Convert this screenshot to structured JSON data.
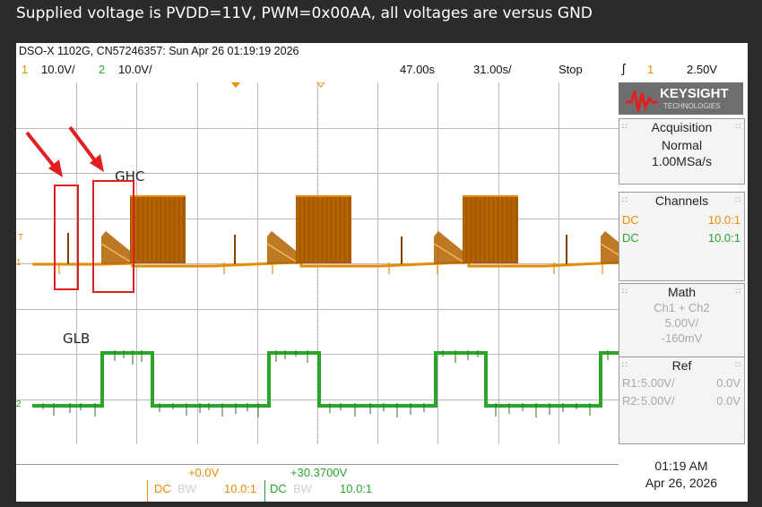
{
  "caption": "Supplied voltage is PVDD=11V, PWM=0x00AA, all voltages are versus GND",
  "status_bar": {
    "model": "DSO-X 1102G, CN57246357: Sun Apr 26 01:19:19 2026",
    "ch1_num": "1",
    "ch1_scale": "10.0V/",
    "ch2_num": "2",
    "ch2_scale": "10.0V/",
    "delay": "47.00s",
    "timebase": "31.00s/",
    "run_state": "Stop",
    "trigger_icon": "trigger-edge-icon",
    "trigger_ch": "1",
    "trigger_level": "2.50V"
  },
  "waveform": {
    "label_ghc": "GHC",
    "label_glb": "GLB",
    "trigger_marker": "T",
    "ch1_marker": "1",
    "ch2_marker": "2",
    "ch1_color": "#e98b00",
    "ch2_color": "#2aa52a",
    "annotation_color": "#e02020",
    "annotation_icon": "red-arrow-icon",
    "grid_divisions": {
      "horizontal": 10,
      "vertical": 8
    }
  },
  "panel": {
    "brand": "KEYSIGHT",
    "brand_sub": "TECHNOLOGIES",
    "acquisition": {
      "title": "Acquisition",
      "mode": "Normal",
      "rate": "1.00MSa/s"
    },
    "channels": {
      "title": "Channels",
      "rows": [
        {
          "coupling": "DC",
          "probe": "10.0:1",
          "color": "#e98b00"
        },
        {
          "coupling": "DC",
          "probe": "10.0:1",
          "color": "#2aa52a"
        }
      ]
    },
    "math": {
      "title": "Math",
      "expr": "Ch1 + Ch2",
      "scale": "5.00V/",
      "offset": "-160mV"
    },
    "ref": {
      "title": "Ref",
      "r1_label": "R1:",
      "r1_scale": "5.00V/",
      "r1_offset": "0.0V",
      "r2_label": "R2:",
      "r2_scale": "5.00V/",
      "r2_offset": "0.0V"
    }
  },
  "bottom": {
    "ch1_offset": "+0.0V",
    "ch2_offset": "+30.3700V",
    "ch1_coupling": "DC",
    "ch1_bw": "BW",
    "ch1_probe": "10.0:1",
    "ch2_coupling": "DC",
    "ch2_bw": "BW",
    "ch2_probe": "10.0:1",
    "time": "01:19 AM",
    "date": "Apr 26, 2026"
  }
}
